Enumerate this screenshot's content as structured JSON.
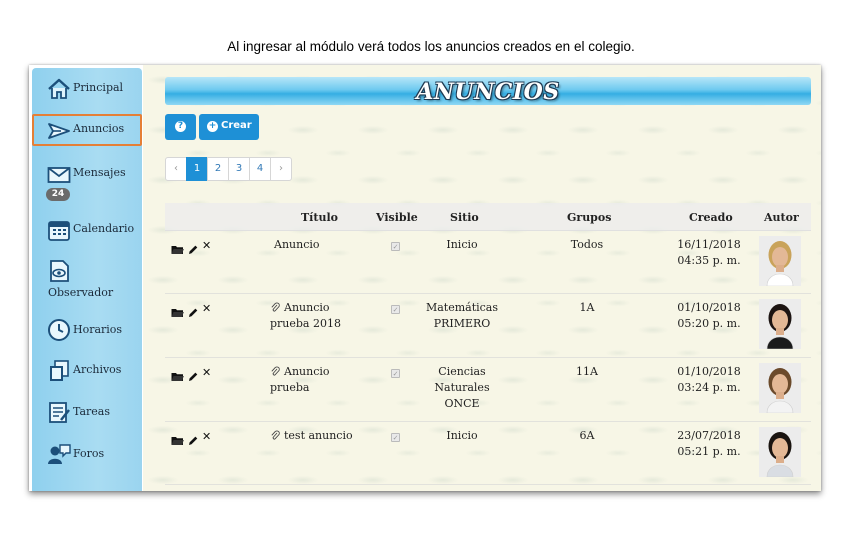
{
  "caption": "Al ingresar al módulo verá todos los anuncios creados en el colegio.",
  "sidebar": {
    "items": [
      {
        "label": "Principal"
      },
      {
        "label": "Anuncios"
      },
      {
        "label": "Mensajes",
        "badge": "24"
      },
      {
        "label": "Calendario"
      },
      {
        "label": "Observador"
      },
      {
        "label": "Horarios"
      },
      {
        "label": "Archivos"
      },
      {
        "label": "Tareas"
      },
      {
        "label": "Foros"
      }
    ]
  },
  "main": {
    "title": "ANUNCIOS",
    "help_label": "?",
    "create_label": "Crear",
    "pagination": {
      "prev": "‹",
      "pages": [
        "1",
        "2",
        "3",
        "4"
      ],
      "current": "1",
      "next": "›"
    },
    "table": {
      "headers": [
        "Título",
        "Visible",
        "Sitio",
        "Grupos",
        "Creado",
        "Autor"
      ],
      "rows": [
        {
          "title_1": "Anuncio",
          "title_2": "",
          "attachment": false,
          "visible": true,
          "site_1": "Inicio",
          "site_2": "",
          "site_3": "",
          "groups": "Todos",
          "date": "16/11/2018",
          "time": "04:35 p. m."
        },
        {
          "title_1": "Anuncio",
          "title_2": "prueba 2018",
          "attachment": true,
          "visible": true,
          "site_1": "Matemáticas",
          "site_2": "PRIMERO",
          "site_3": "",
          "groups": "1A",
          "date": "01/10/2018",
          "time": "05:20 p. m."
        },
        {
          "title_1": "Anuncio",
          "title_2": "prueba",
          "attachment": true,
          "visible": true,
          "site_1": "Ciencias",
          "site_2": "Naturales",
          "site_3": "ONCE",
          "groups": "11A",
          "date": "01/10/2018",
          "time": "03:24 p. m."
        },
        {
          "title_1": "test anuncio",
          "title_2": "",
          "attachment": true,
          "visible": true,
          "site_1": "Inicio",
          "site_2": "",
          "site_3": "",
          "groups": "6A",
          "date": "23/07/2018",
          "time": "05:21 p. m."
        }
      ]
    }
  },
  "colors": {
    "sidebar": "#a9dcf2",
    "accent": "#1e90d6",
    "active_border": "#e57f36",
    "background": "#f7f6e6"
  },
  "icons": [
    "home-icon",
    "megaphone-icon",
    "envelope-icon",
    "calendar-icon",
    "eye-document-icon",
    "clock-icon",
    "files-icon",
    "tasks-icon",
    "forum-icon",
    "folder-icon",
    "pencil-icon",
    "close-icon",
    "paperclip-icon",
    "checkbox-icon"
  ]
}
